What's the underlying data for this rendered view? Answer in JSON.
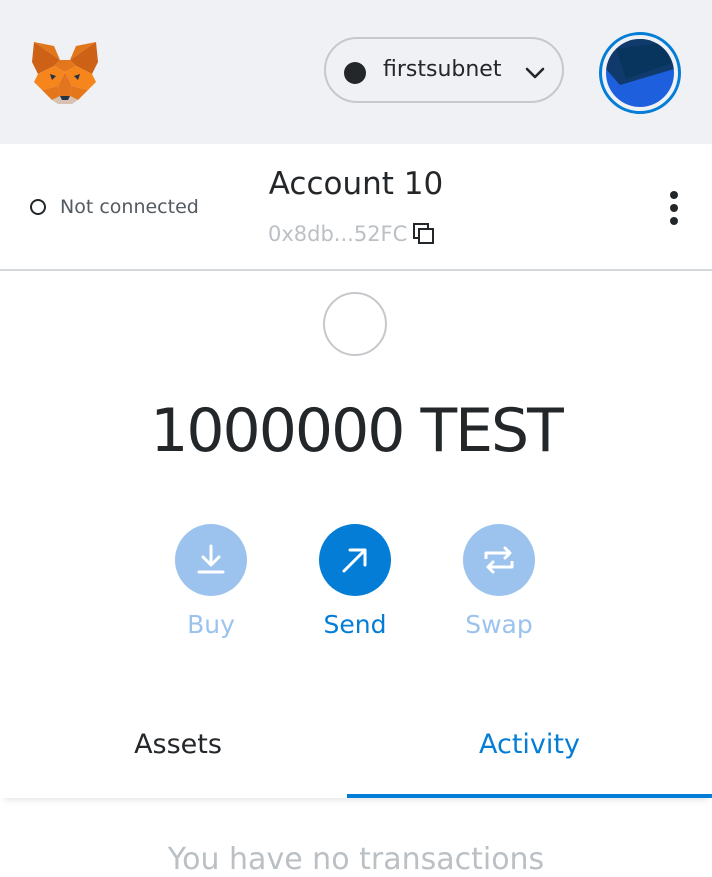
{
  "header": {
    "logo_icon": "metamask-fox-icon",
    "network": {
      "name": "firstsubnet",
      "dot_color": "#24272a"
    },
    "avatar_icon": "jazzicon-avatar"
  },
  "account": {
    "connection_status": "Not connected",
    "name": "Account 10",
    "address_short": "0x8db...52FC",
    "copy_icon": "copy-icon",
    "menu_icon": "kebab-menu-icon"
  },
  "balance": {
    "amount": "1000000",
    "symbol": "TEST",
    "display": "1000000 TEST"
  },
  "actions": [
    {
      "label": "Buy",
      "icon": "download-icon",
      "color": "#9cc3ee"
    },
    {
      "label": "Send",
      "icon": "arrow-up-right-icon",
      "color": "#037dd6"
    },
    {
      "label": "Swap",
      "icon": "swap-arrows-icon",
      "color": "#9cc3ee"
    }
  ],
  "tabs": [
    {
      "label": "Assets",
      "active": false
    },
    {
      "label": "Activity",
      "active": true
    }
  ],
  "activity": {
    "empty_message": "You have no transactions"
  },
  "colors": {
    "accent": "#037dd6",
    "accent_disabled": "#9cc3ee",
    "header_bg": "#eff1f4"
  }
}
